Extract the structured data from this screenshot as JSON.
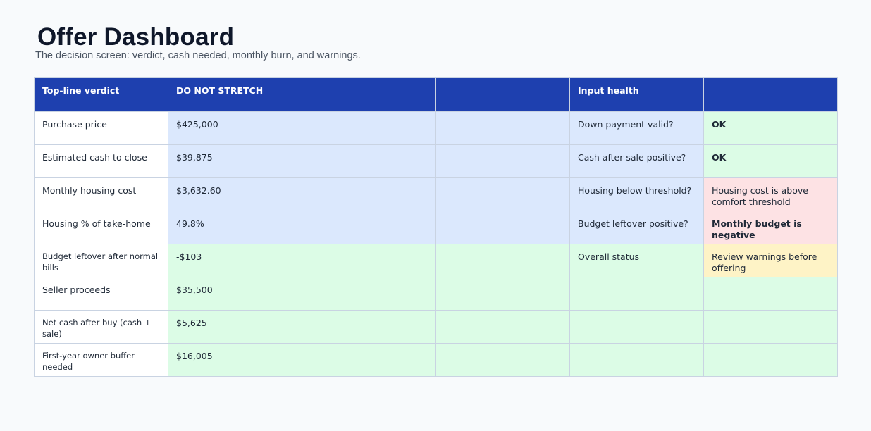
{
  "header": {
    "title": "Offer Dashboard",
    "subtitle": "The decision screen: verdict, cash needed, monthly burn, and warnings."
  },
  "table": {
    "head": {
      "verdict_label": "Top-line verdict",
      "verdict_value": "DO NOT STRETCH",
      "health_label": "Input health"
    },
    "rows": [
      {
        "label": "Purchase price",
        "value": "$425,000",
        "check": "Down payment valid?",
        "status": "OK"
      },
      {
        "label": "Estimated cash to close",
        "value": "$39,875",
        "check": "Cash after sale positive?",
        "status": "OK"
      },
      {
        "label": "Monthly housing cost",
        "value": "$3,632.60",
        "check": "Housing below threshold?",
        "status": "Housing cost is above comfort threshold"
      },
      {
        "label": "Housing % of take-home",
        "value": "49.8%",
        "check": "Budget leftover positive?",
        "status": "Monthly budget is negative"
      },
      {
        "label": "Budget leftover after normal bills",
        "value": "-$103",
        "check": "Overall status",
        "status": "Review warnings before offering"
      },
      {
        "label": "Seller proceeds",
        "value": "$35,500"
      },
      {
        "label": "Net cash after buy (cash + sale)",
        "value": "$5,625"
      },
      {
        "label": "First-year owner buffer needed",
        "value": "$16,005"
      }
    ]
  },
  "colors": {
    "header_bg": "#1e40af",
    "input_blue": "#dbe8fd",
    "output_green": "#dcfce6",
    "warning_red": "#fde2e4",
    "warning_yellow": "#fef3c6"
  }
}
